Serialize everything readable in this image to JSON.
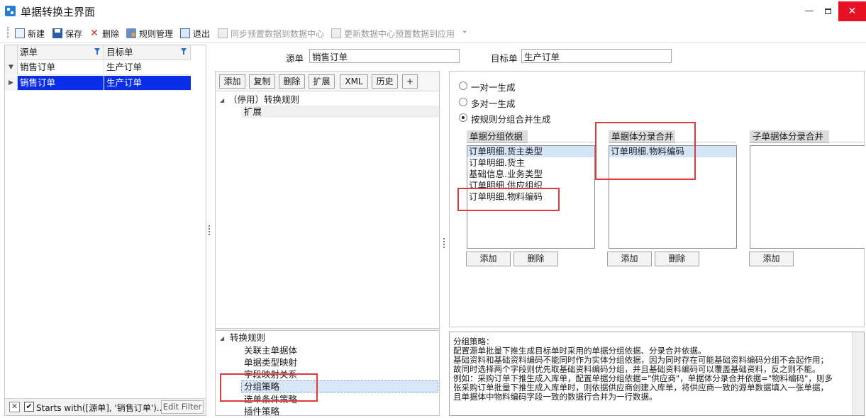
{
  "window": {
    "title": "单据转换主界面",
    "controls": {
      "minimize": "—",
      "maximize": "",
      "close": "✕"
    }
  },
  "toolbar": {
    "new": "新建",
    "save": "保存",
    "delete": "删除",
    "rule_manage": "规则管理",
    "exit": "退出",
    "sync_preset": "同步预置数据到数据中心",
    "update_preset": "更新数据中心预置数据到应用",
    "more": "⌄"
  },
  "left_grid": {
    "columns": [
      "源单",
      "目标单"
    ],
    "filter_row": {
      "indicator": "▼",
      "source": "销售订单",
      "target": "生产订单"
    },
    "selected_row": {
      "indicator": "▶",
      "source": "销售订单",
      "target": "生产订单"
    },
    "filter_bar": {
      "close": "✕",
      "checked": "✔",
      "text": "Starts with([源单], '销售订单')..",
      "edit_filter": "Edit Filter"
    }
  },
  "header_fields": {
    "source_label": "源单",
    "source_value": "销售订单",
    "target_label": "目标单",
    "target_value": "生产订单"
  },
  "mid_toolbar": [
    "添加",
    "复制",
    "删除",
    "扩展",
    "XML",
    "历史",
    "+"
  ],
  "top_tree": {
    "root": "（停用）转换规则",
    "root_toggle": "◢",
    "child": "扩展"
  },
  "bottom_tree": {
    "root": "转换规则",
    "root_toggle": "◢",
    "items": [
      "关联主单据体",
      "单据类型映射",
      "字段映射关系",
      "分组策略",
      "选单条件策略",
      "插件策略"
    ],
    "selected_index": 3
  },
  "generation_mode": {
    "options": [
      "一对一生成",
      "多对一生成",
      "按规则分组合并生成"
    ],
    "selected_index": 2
  },
  "groups": {
    "bill_group": {
      "title": "单据分组依据",
      "items": [
        "订单明细.货主类型",
        "订单明细.货主",
        "基础信息.业务类型",
        "订单明细.供应组织",
        "订单明细.物料编码"
      ],
      "highlight_index": 0,
      "add": "添加",
      "remove": "删除"
    },
    "body_merge": {
      "title": "单据体分录合并",
      "items": [
        "订单明细.物料编码"
      ],
      "highlight_index": 0,
      "add": "添加",
      "remove": "删除"
    },
    "sub_merge": {
      "title": "子单据体分录合并",
      "items": [],
      "add": "添加"
    }
  },
  "description": {
    "lines": [
      "分组策略：",
      "配置源单批量下推生成目标单时采用的单据分组依据、分录合并依据。",
      "基础资料和基础资料编码不能同时作为实体分组依据，因为同时存在可能基础资料编码分组不会起作用；",
      "故同时选择两个字段则优先取基础资料编码分组，并且基础资料编码可以覆盖基础资料，反之则不能。",
      "例如：采购订单下推生成入库单，配置单据分组依据=\"供应商\"，单据体分录合并依据=\"物料编码\"，则多",
      "张采购订单批量下推生成入库单时，则依据供应商创建入库单，将供应商一致的源单数据填入一张单据，",
      "且单据体中物料编码字段一致的数据行合并为一行数据。"
    ]
  },
  "colors": {
    "selection": "#0a2ee8",
    "highlight": "#d5e5f8",
    "annotation": "#e23a3a",
    "close_button": "#e81123"
  }
}
